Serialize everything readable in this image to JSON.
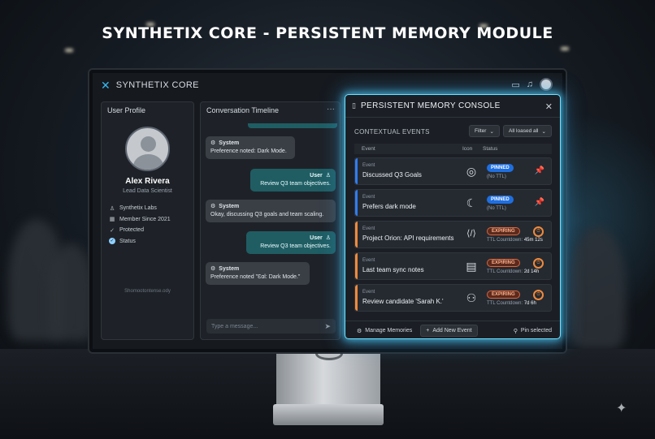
{
  "headline": "SYNTHETIX CORE - PERSISTENT MEMORY MODULE",
  "app": {
    "brand": "SYNTHETIX CORE",
    "brand_icon": "x-logo-icon"
  },
  "profile": {
    "title": "User Profile",
    "name": "Alex Rivera",
    "role": "Lead Data Scientist",
    "items": [
      {
        "icon": "user-icon",
        "label": "Synthetix Labs"
      },
      {
        "icon": "calendar-icon",
        "label": "Member Since 2021"
      },
      {
        "icon": "check-icon",
        "label": "Protected"
      },
      {
        "icon": "status-check-icon",
        "label": "Status"
      }
    ],
    "footer": "Shomootontense.ody"
  },
  "timeline": {
    "title": "Conversation Timeline",
    "messages": [
      {
        "role": "System",
        "text": "Preference noted: Dark Mode."
      },
      {
        "role": "User",
        "text": "Review Q3 team objectives."
      },
      {
        "role": "System",
        "text": "Okay, discussing Q3 goals and team scaling."
      },
      {
        "role": "User",
        "text": "Review Q3 team objectives."
      },
      {
        "role": "System",
        "text": "Preference noted \"Ɛɑl: Dark Mode.\""
      }
    ],
    "composer_placeholder": "Type a message..."
  },
  "console": {
    "title": "PERSISTENT MEMORY CONSOLE",
    "section": "CONTEXTUAL EVENTS",
    "filter_label": "Filter",
    "scope_label": "All loased all",
    "columns": {
      "event": "Event",
      "icon": "Icon",
      "status": "Status"
    },
    "rows": [
      {
        "label": "Event",
        "title": "Discussed Q3 Goals",
        "icon": "target-icon",
        "status": "PINNED",
        "meta": "(No TTL)",
        "accent": "#2f7cf0"
      },
      {
        "label": "Event",
        "title": "Prefers dark mode",
        "icon": "moon-icon",
        "status": "PINNED",
        "meta": "(No TTL)",
        "accent": "#2f7cf0"
      },
      {
        "label": "Event",
        "title": "Project Orion: API requirements",
        "icon": "code-icon",
        "status": "EXPIRING",
        "meta_label": "TTL Countdown:",
        "meta_value": "45m 12s",
        "accent": "#f08a3c"
      },
      {
        "label": "Event",
        "title": "Last team sync notes",
        "icon": "document-icon",
        "status": "EXPIRING",
        "meta_label": "TTL Countdown:",
        "meta_value": "2d 14h",
        "accent": "#f08a3c"
      },
      {
        "label": "Event",
        "title": "Review candidate 'Sarah K.'",
        "icon": "people-icon",
        "status": "EXPIRING",
        "meta_label": "TTL Countdown:",
        "meta_value": "7d 6h",
        "accent": "#f08a3c"
      }
    ],
    "footer": {
      "manage": "Manage Memories",
      "add": "Add New Event",
      "pin": "Pin selected"
    }
  },
  "colors": {
    "accent_glow": "#6fe0ff",
    "pinned": "#1f6fe0",
    "expiring": "#f08a3c",
    "user_bubble": "#1f5d63"
  }
}
